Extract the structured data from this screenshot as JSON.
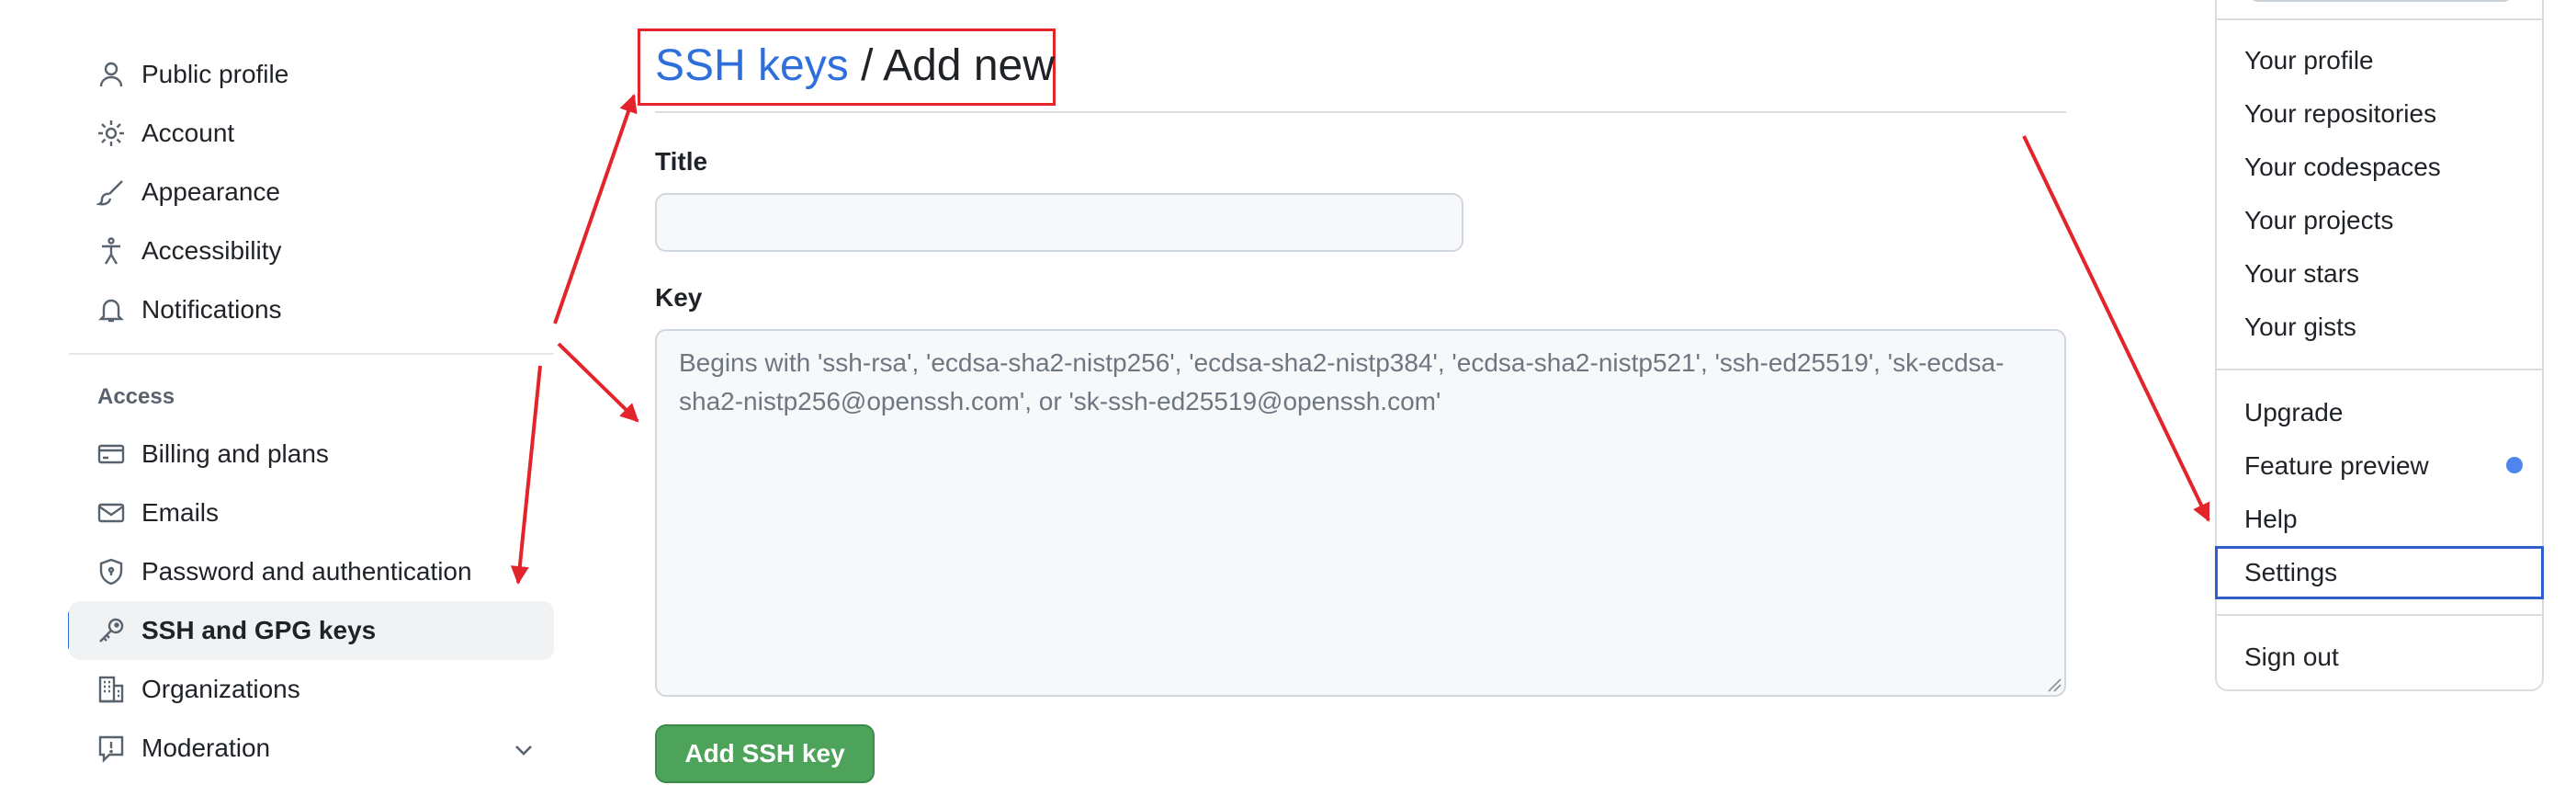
{
  "sidebar": {
    "items": [
      {
        "label": "Public profile",
        "icon": "person-icon"
      },
      {
        "label": "Account",
        "icon": "gear-icon"
      },
      {
        "label": "Appearance",
        "icon": "paintbrush-icon"
      },
      {
        "label": "Accessibility",
        "icon": "accessibility-icon"
      },
      {
        "label": "Notifications",
        "icon": "bell-icon"
      }
    ],
    "section_label": "Access",
    "access_items": [
      {
        "label": "Billing and plans",
        "icon": "credit-card-icon"
      },
      {
        "label": "Emails",
        "icon": "mail-icon"
      },
      {
        "label": "Password and authentication",
        "icon": "shield-icon"
      },
      {
        "label": "SSH and GPG keys",
        "icon": "key-icon",
        "selected": true
      },
      {
        "label": "Organizations",
        "icon": "organization-icon"
      },
      {
        "label": "Moderation",
        "icon": "report-icon",
        "expandable": true
      }
    ]
  },
  "main": {
    "breadcrumb_link": "SSH keys",
    "breadcrumb_rest": " / Add new",
    "title_label": "Title",
    "title_value": "",
    "key_label": "Key",
    "key_placeholder": "Begins with 'ssh-rsa', 'ecdsa-sha2-nistp256', 'ecdsa-sha2-nistp384', 'ecdsa-sha2-nistp521', 'ssh-ed25519', 'sk-ecdsa-sha2-nistp256@openssh.com', or 'sk-ssh-ed25519@openssh.com'",
    "submit_label": "Add SSH key"
  },
  "menu": {
    "group1": [
      "Your profile",
      "Your repositories",
      "Your codespaces",
      "Your projects",
      "Your stars",
      "Your gists"
    ],
    "group2": [
      "Upgrade",
      "Feature preview",
      "Help",
      "Settings"
    ],
    "group3": [
      "Sign out"
    ],
    "highlighted": "Settings"
  },
  "colors": {
    "accent": "#2f6fdc",
    "annotation": "#e3242b",
    "primary_button": "#4ea35b",
    "selected_bar": "#2f6fdc"
  }
}
